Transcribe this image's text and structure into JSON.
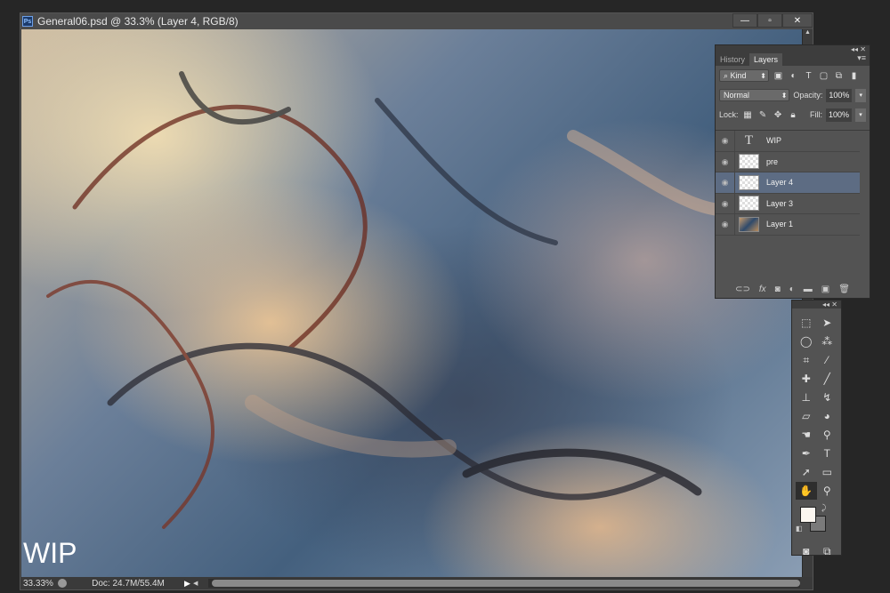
{
  "document": {
    "title": "General06.psd @ 33.3% (Layer 4, RGB/8)",
    "app_icon": "Ps",
    "canvas_text": "WIP"
  },
  "status": {
    "zoom": "33.33%",
    "doc": "Doc: 24.7M/55.4M"
  },
  "window_buttons": {
    "minimize": "—",
    "maximize": "▫",
    "close": "✕"
  },
  "layers_panel": {
    "tabs": [
      "History",
      "Layers"
    ],
    "filter": "Kind",
    "blend_mode": "Normal",
    "opacity_label": "Opacity:",
    "opacity": "100%",
    "lock_label": "Lock:",
    "fill_label": "Fill:",
    "fill": "100%",
    "layers": [
      {
        "name": "WIP",
        "type": "text"
      },
      {
        "name": "pre",
        "type": "empty"
      },
      {
        "name": "Layer 4",
        "type": "empty",
        "active": true
      },
      {
        "name": "Layer 3",
        "type": "empty"
      },
      {
        "name": "Layer 1",
        "type": "image"
      }
    ],
    "type_glyph": "T"
  },
  "tools": [
    "marquee",
    "move",
    "lasso",
    "magic-wand",
    "crop",
    "eyedropper",
    "healing",
    "brush",
    "stamp",
    "history-brush",
    "eraser",
    "paint-bucket",
    "smudge",
    "dodge",
    "pen",
    "type",
    "path-select",
    "rectangle",
    "hand",
    "zoom"
  ],
  "colors": {
    "foreground": "#fbf6f0",
    "background": "#7a7a7a"
  }
}
